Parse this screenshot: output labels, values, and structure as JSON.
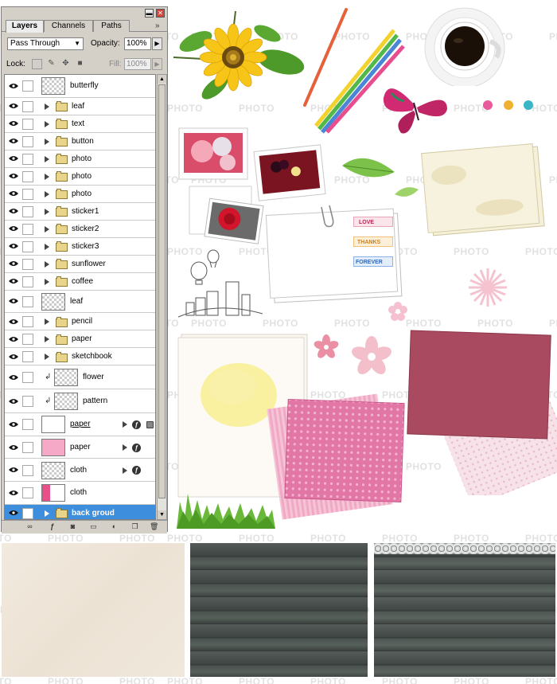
{
  "panel": {
    "tabs": [
      {
        "label": "Layers",
        "active": true
      },
      {
        "label": "Channels",
        "active": false
      },
      {
        "label": "Paths",
        "active": false
      }
    ],
    "blend_mode": "Pass Through",
    "opacity_label": "Opacity:",
    "opacity_value": "100%",
    "lock_label": "Lock:",
    "fill_label": "Fill:",
    "fill_value": "100%",
    "layers": [
      {
        "name": "butterfly",
        "kind": "layer"
      },
      {
        "name": "leaf",
        "kind": "group"
      },
      {
        "name": "text",
        "kind": "group"
      },
      {
        "name": "button",
        "kind": "group"
      },
      {
        "name": "photo",
        "kind": "group"
      },
      {
        "name": "photo",
        "kind": "group"
      },
      {
        "name": "photo",
        "kind": "group"
      },
      {
        "name": "sticker1",
        "kind": "group"
      },
      {
        "name": "sticker2",
        "kind": "group"
      },
      {
        "name": "sticker3",
        "kind": "group"
      },
      {
        "name": "sunflower",
        "kind": "group"
      },
      {
        "name": "coffee",
        "kind": "group"
      },
      {
        "name": "leaf",
        "kind": "layer"
      },
      {
        "name": "pencil",
        "kind": "group"
      },
      {
        "name": "paper",
        "kind": "group"
      },
      {
        "name": "sketchbook",
        "kind": "group"
      },
      {
        "name": "flower",
        "kind": "clip"
      },
      {
        "name": "pattern",
        "kind": "clip"
      },
      {
        "name": "paper",
        "kind": "fx"
      },
      {
        "name": "paper",
        "kind": "fx"
      },
      {
        "name": "cloth",
        "kind": "fx"
      },
      {
        "name": "cloth",
        "kind": "layer"
      },
      {
        "name": "back groud",
        "kind": "group",
        "selected": true
      }
    ]
  },
  "stickers": {
    "love": "LOVE",
    "thanks": "THANKS",
    "forever": "FOREVER"
  },
  "watermark": "PHOTO",
  "colors": {
    "selection": "#3d8fdd",
    "panel_bg": "#d4d0c8",
    "pink_paper": "#e27aa7",
    "mauve_card": "#a94a60",
    "wood": "#4a5250"
  }
}
